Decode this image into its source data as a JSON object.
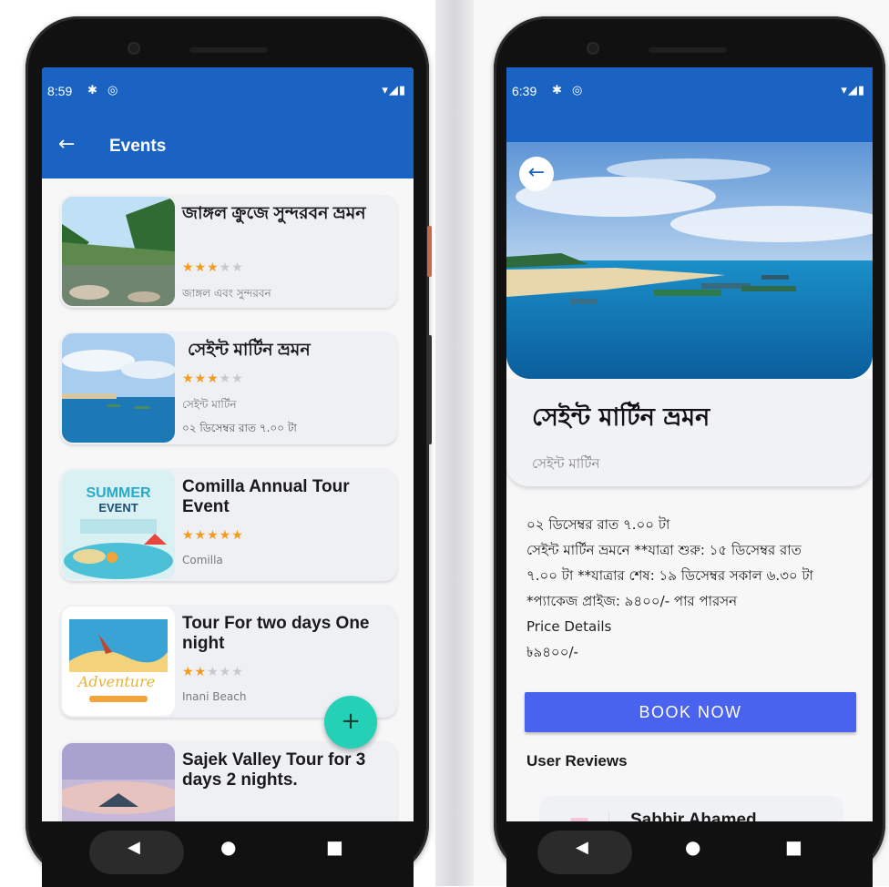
{
  "left_phone": {
    "status": {
      "time": "8:59",
      "right_icons": "▾◢▮"
    },
    "appbar": {
      "title": "Events"
    },
    "events": [
      {
        "title": "জাঙ্গল ক্রুজে সুন্দরবন ভ্রমন",
        "rating": 3,
        "location": "জাঙ্গল এবং সুন্দরবন",
        "date": ""
      },
      {
        "title": "সেইন্ট মার্টিন ভ্রমন",
        "rating": 3,
        "location": "সেইন্ট মার্টিন",
        "date": "০২ ডিসেম্বর রাত ৭.০০ টা"
      },
      {
        "title": "Comilla Annual Tour Event",
        "rating": 5,
        "location": "Comilla",
        "date": ""
      },
      {
        "title": "Tour For two days One night",
        "rating": 2,
        "location": "Inani Beach",
        "date": ""
      },
      {
        "title": "Sajek Valley Tour for 3 days 2 nights.",
        "rating": 0,
        "location": "",
        "date": ""
      }
    ],
    "thumb_text": {
      "summer": "SUMMER",
      "event": "EVENT",
      "adventure": "Adventure"
    },
    "fab_label": "+"
  },
  "right_phone": {
    "status": {
      "time": "6:39",
      "right_icons": "▾◢▮"
    },
    "title": "সেইন্ট মার্টিন ভ্রমন",
    "location": "সেইন্ট মার্টিন",
    "description_lines": [
      "০২ ডিসেম্বর রাত ৭.০০ টা",
      " সেইন্ট মার্টিন ভ্রমনে **যাত্রা শুরু: ১৫ ডিসেম্বর রাত",
      "৭.০০ টা  **যাত্রার শেষ: ১৯ ডিসেম্বর সকাল ৬.৩০ টা",
      "*প্যাকেজ প্রাইজ: ৯৪০০/- পার পারসন",
      " Price Details",
      "৳৯৪০০/-"
    ],
    "book_label": "BOOK NOW",
    "reviews_heading": "User Reviews",
    "reviewer_name": "Sabbir Ahamed"
  },
  "colors": {
    "primary": "#1b63c2",
    "accent": "#24d1b6",
    "book_button": "#4a63ef",
    "star": "#f59a1a"
  },
  "icons": {
    "back": "arrow-left-icon",
    "settings": "gear-icon",
    "sync": "sync-icon",
    "wifi": "wifi-icon",
    "signal": "signal-icon",
    "battery": "battery-icon",
    "nav_back": "triangle-back-icon",
    "nav_home": "circle-home-icon",
    "nav_recent": "square-recent-icon"
  }
}
